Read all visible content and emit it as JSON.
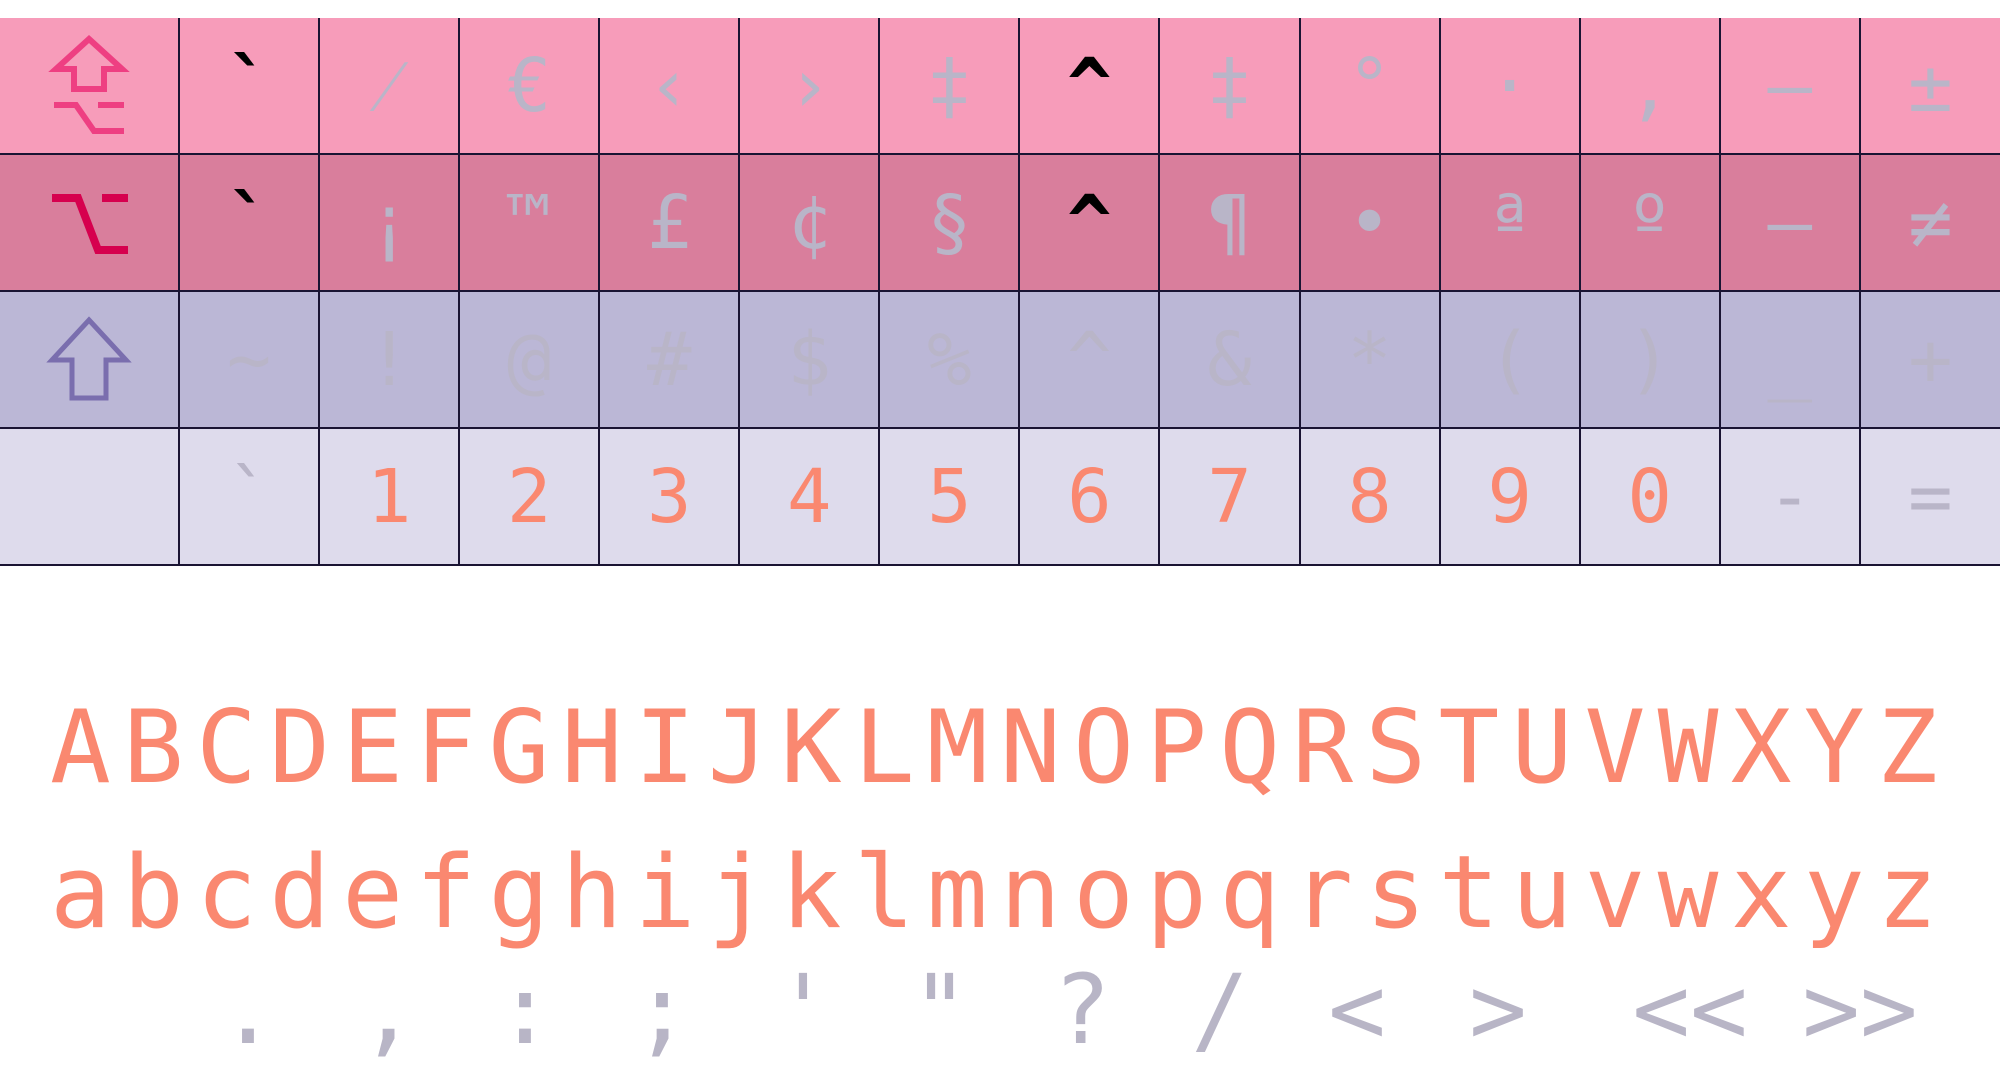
{
  "colors": {
    "row_option_shift": "#f79cba",
    "row_option": "#d97e9c",
    "row_shift": "#bbb7d6",
    "row_base": "#dedbec",
    "grid_line": "#1a1433",
    "glyph_active": "#000000",
    "glyph_dim": "#b9b5c8",
    "glyph_base": "#fa8870",
    "option_shift_icon": "#ee3f82",
    "option_icon": "#d6004e",
    "shift_icon": "#7a6eae"
  },
  "keyboard": {
    "rows": [
      {
        "modifier_icon": "option-shift-icon",
        "keys": [
          {
            "char": "`",
            "state": "active"
          },
          {
            "char": "⁄",
            "state": "dim"
          },
          {
            "char": "€",
            "state": "dim"
          },
          {
            "char": "‹",
            "state": "dim"
          },
          {
            "char": "›",
            "state": "dim"
          },
          {
            "char": "‡",
            "state": "dim"
          },
          {
            "char": "^",
            "state": "active"
          },
          {
            "char": "‡",
            "state": "dim"
          },
          {
            "char": "°",
            "state": "dim"
          },
          {
            "char": "·",
            "state": "dim"
          },
          {
            "char": "‚",
            "state": "dim"
          },
          {
            "char": "—",
            "state": "dim"
          },
          {
            "char": "±",
            "state": "dim"
          }
        ]
      },
      {
        "modifier_icon": "option-icon",
        "keys": [
          {
            "char": "`",
            "state": "active"
          },
          {
            "char": "¡",
            "state": "dim"
          },
          {
            "char": "™",
            "state": "dim"
          },
          {
            "char": "£",
            "state": "dim"
          },
          {
            "char": "¢",
            "state": "dim"
          },
          {
            "char": "§",
            "state": "dim"
          },
          {
            "char": "^",
            "state": "active"
          },
          {
            "char": "¶",
            "state": "dim"
          },
          {
            "char": "•",
            "state": "dim"
          },
          {
            "char": "ª",
            "state": "dim"
          },
          {
            "char": "º",
            "state": "dim"
          },
          {
            "char": "–",
            "state": "dim"
          },
          {
            "char": "≠",
            "state": "dim"
          }
        ]
      },
      {
        "modifier_icon": "shift-icon",
        "keys": [
          {
            "char": "~",
            "state": "dim"
          },
          {
            "char": "!",
            "state": "dim"
          },
          {
            "char": "@",
            "state": "dim"
          },
          {
            "char": "#",
            "state": "dim"
          },
          {
            "char": "$",
            "state": "dim"
          },
          {
            "char": "%",
            "state": "dim"
          },
          {
            "char": "^",
            "state": "dim"
          },
          {
            "char": "&",
            "state": "dim"
          },
          {
            "char": "*",
            "state": "dim"
          },
          {
            "char": "(",
            "state": "dim"
          },
          {
            "char": ")",
            "state": "dim"
          },
          {
            "char": "_",
            "state": "dim"
          },
          {
            "char": "+",
            "state": "dim"
          }
        ]
      },
      {
        "modifier_icon": "",
        "keys": [
          {
            "char": "`",
            "state": "dim"
          },
          {
            "char": "1",
            "state": "base"
          },
          {
            "char": "2",
            "state": "base"
          },
          {
            "char": "3",
            "state": "base"
          },
          {
            "char": "4",
            "state": "base"
          },
          {
            "char": "5",
            "state": "base"
          },
          {
            "char": "6",
            "state": "base"
          },
          {
            "char": "7",
            "state": "base"
          },
          {
            "char": "8",
            "state": "base"
          },
          {
            "char": "9",
            "state": "base"
          },
          {
            "char": "0",
            "state": "base"
          },
          {
            "char": "-",
            "state": "dim"
          },
          {
            "char": "=",
            "state": "dim"
          }
        ]
      }
    ]
  },
  "alphabet": {
    "upper": "ABCDEFGHIJKLMNOPQRSTUVWXYZ",
    "lower": "abcdefghijklmnopqrstuvwxyz"
  },
  "punctuation": [
    ".",
    ",",
    ":",
    ";",
    "'",
    "\"",
    "?",
    "/",
    "<",
    ">",
    "<<",
    ">>"
  ]
}
